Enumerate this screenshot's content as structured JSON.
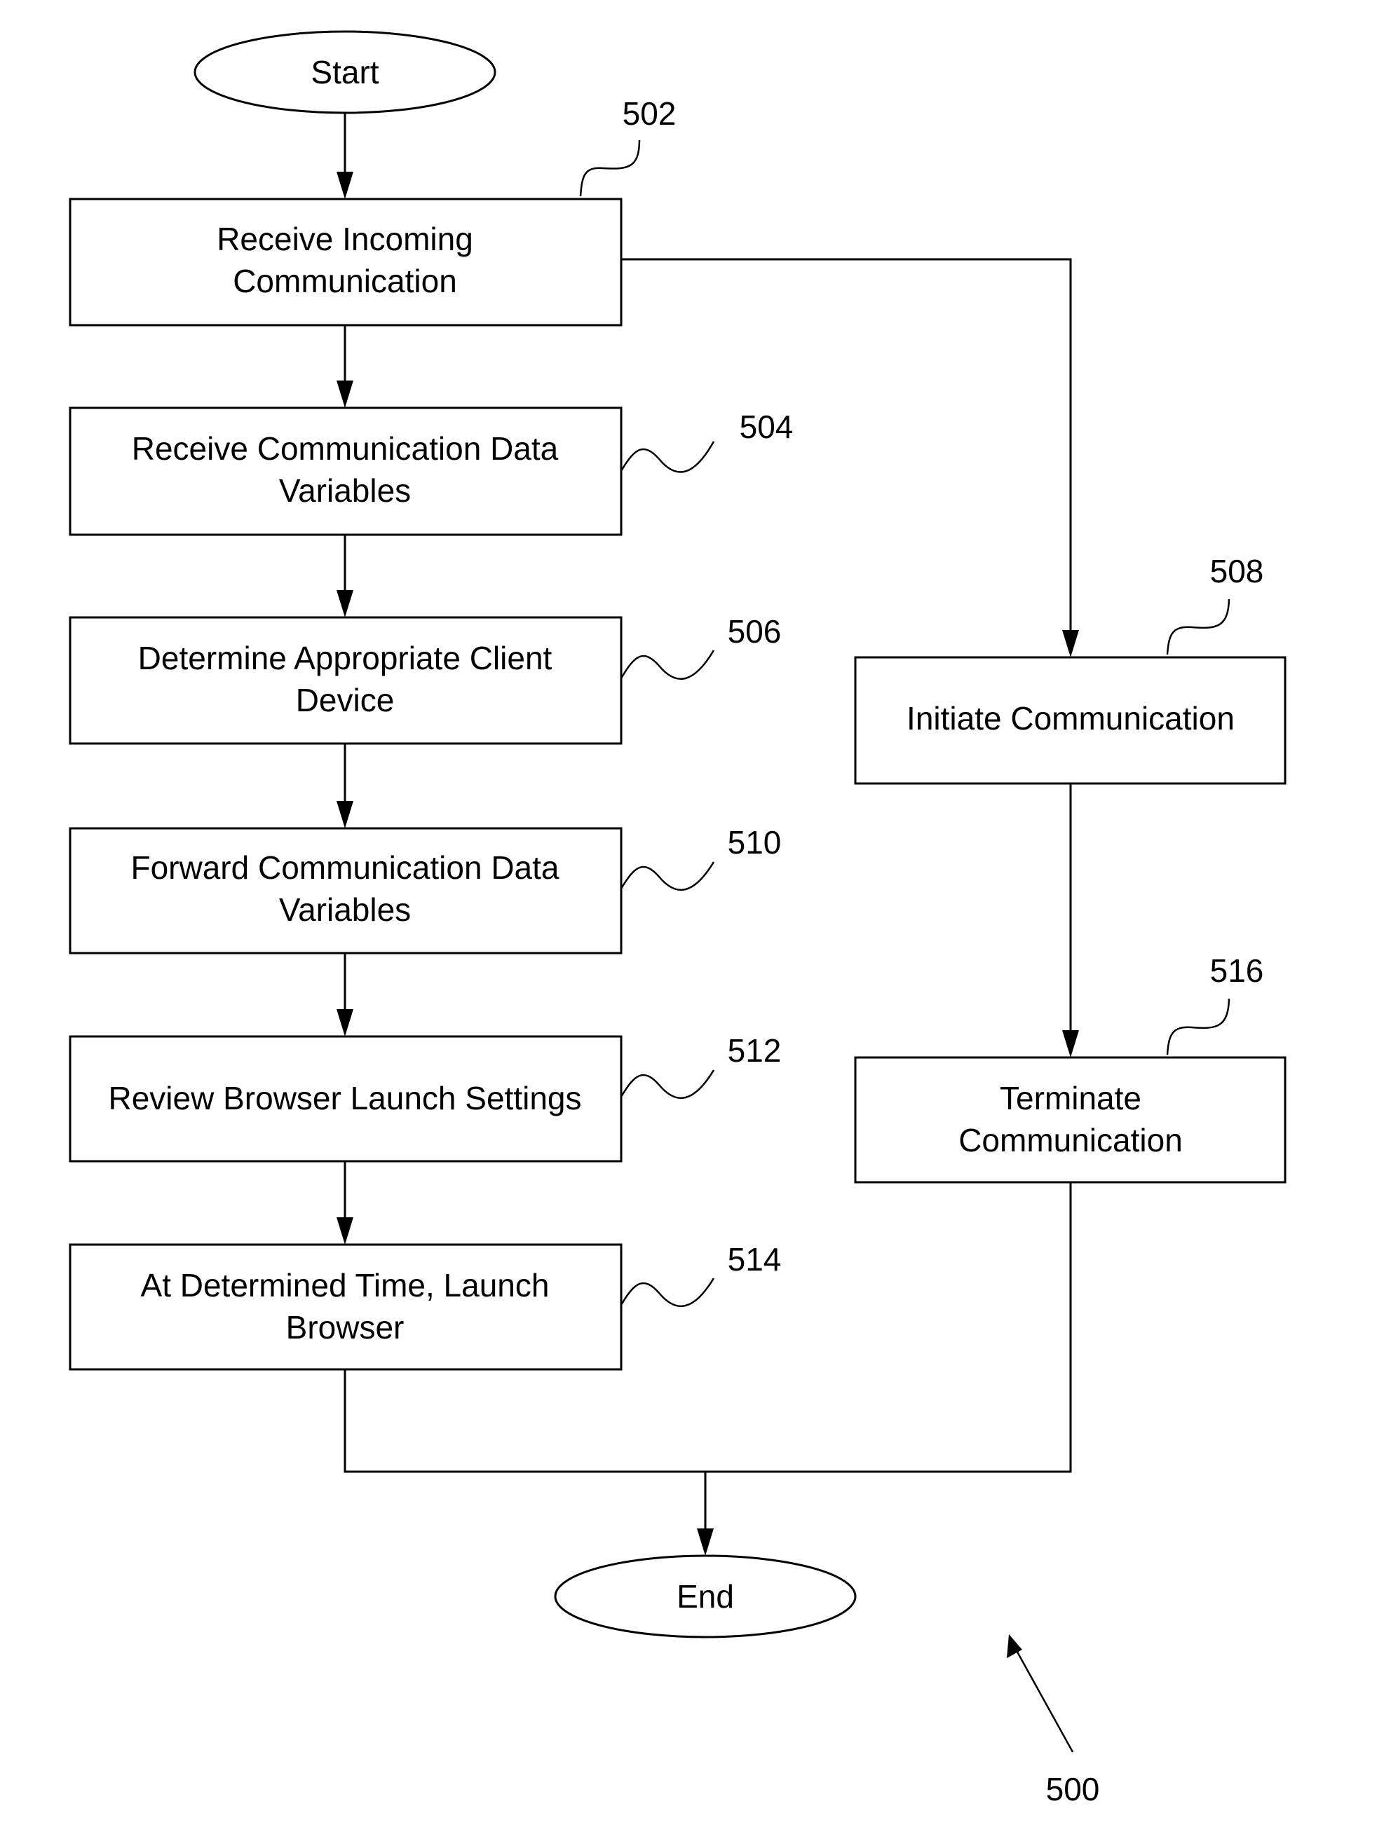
{
  "diagram": {
    "figure_ref": "500",
    "terminals": {
      "start": "Start",
      "end": "End"
    },
    "steps": [
      {
        "id": "502",
        "lines": [
          "Receive Incoming",
          "Communication"
        ]
      },
      {
        "id": "504",
        "lines": [
          "Receive Communication Data",
          "Variables"
        ]
      },
      {
        "id": "506",
        "lines": [
          "Determine Appropriate Client",
          "Device"
        ]
      },
      {
        "id": "510",
        "lines": [
          "Forward Communication Data",
          "Variables"
        ]
      },
      {
        "id": "512",
        "lines": [
          "Review Browser Launch Settings"
        ]
      },
      {
        "id": "514",
        "lines": [
          "At Determined Time, Launch",
          "Browser"
        ]
      },
      {
        "id": "508",
        "lines": [
          "Initiate Communication"
        ]
      },
      {
        "id": "516",
        "lines": [
          "Terminate",
          "Communication"
        ]
      }
    ],
    "edges": [
      [
        "Start",
        "502"
      ],
      [
        "502",
        "504"
      ],
      [
        "504",
        "506"
      ],
      [
        "506",
        "510"
      ],
      [
        "510",
        "512"
      ],
      [
        "512",
        "514"
      ],
      [
        "514",
        "End"
      ],
      [
        "502",
        "508"
      ],
      [
        "508",
        "516"
      ],
      [
        "516",
        "End"
      ]
    ]
  }
}
